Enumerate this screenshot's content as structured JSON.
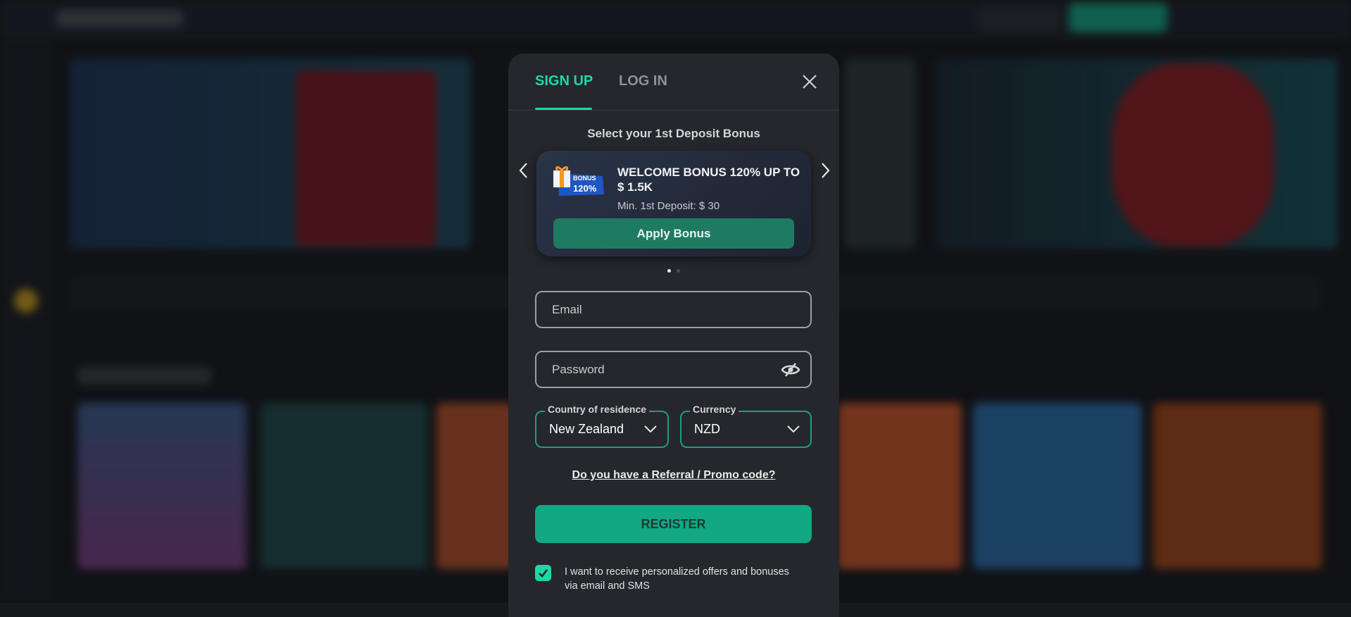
{
  "colors": {
    "accent": "#1ed7a5",
    "register": "#12a883",
    "apply": "#1f7a62",
    "modal_bg": "#25272d"
  },
  "modal": {
    "tabs": [
      {
        "label": "SIGN UP",
        "active": true
      },
      {
        "label": "LOG IN",
        "active": false
      }
    ],
    "close_icon": "close-icon",
    "bonus_heading": "Select your 1st Deposit Bonus",
    "bonus": {
      "badge_word": "BONUS",
      "badge_pct": "120%",
      "title": "WELCOME BONUS 120% UP TO $ 1.5K",
      "min_deposit": "Min. 1st Deposit: $ 30",
      "apply_label": "Apply Bonus"
    },
    "carousel": {
      "pages": 2,
      "current": 1
    },
    "email_placeholder": "Email",
    "password_placeholder": "Password",
    "country": {
      "label": "Country of residence",
      "value": "New Zealand"
    },
    "currency": {
      "label": "Currency",
      "value": "NZD"
    },
    "promo_link": "Do you have a Referral / Promo code?",
    "register_label": "REGISTER",
    "offers_checkbox": {
      "checked": true,
      "label": "I want to receive personalized offers and bonuses via email and SMS"
    }
  }
}
